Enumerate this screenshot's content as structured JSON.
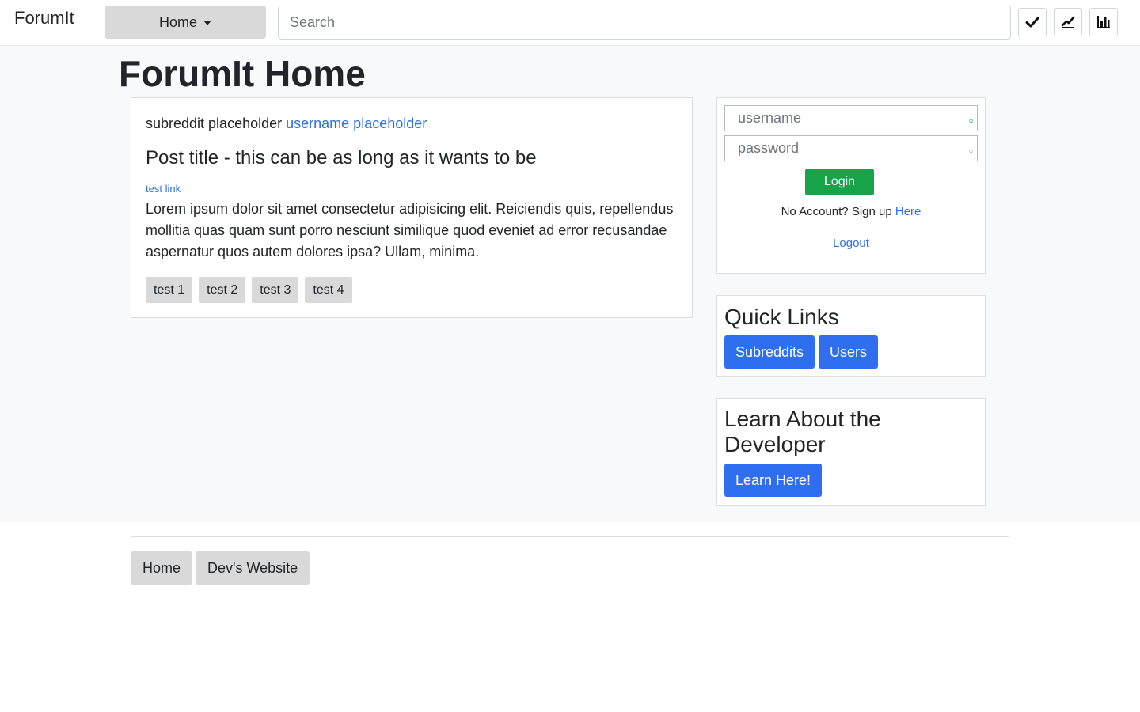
{
  "navbar": {
    "brand": "ForumIt",
    "home_dropdown": "Home",
    "search_placeholder": "Search",
    "icons": [
      "check-icon",
      "line-chart-icon",
      "bar-chart-icon"
    ]
  },
  "page": {
    "title": "ForumIt Home"
  },
  "post": {
    "subreddit": "subreddit placeholder",
    "username": "username placeholder",
    "title": "Post title - this can be as long as it wants to be",
    "link_text": "test link",
    "body": "Lorem ipsum dolor sit amet consectetur adipisicing elit. Reiciendis quis, repellendus mollitia quas quam sunt porro nesciunt similique quod eveniet ad error recusandae aspernatur quos autem dolores ipsa? Ullam, minima.",
    "tags": [
      "test 1",
      "test 2",
      "test 3",
      "test 4"
    ]
  },
  "login": {
    "username_placeholder": "username",
    "password_placeholder": "password",
    "login_label": "Login",
    "signup_text": "No Account? Sign up",
    "signup_link": "Here",
    "logout_label": "Logout"
  },
  "quick_links": {
    "title": "Quick Links",
    "subreddits_label": "Subreddits",
    "users_label": "Users"
  },
  "developer": {
    "title": "Learn About the Developer",
    "button_label": "Learn Here!"
  },
  "footer": {
    "home_label": "Home",
    "dev_site_label": "Dev's Website"
  },
  "colors": {
    "primary": "#2f6fef",
    "success": "#16a34a",
    "link": "#2f6fe0",
    "secondary_button": "#d9d9d9",
    "page_background": "#f8f9fa"
  }
}
